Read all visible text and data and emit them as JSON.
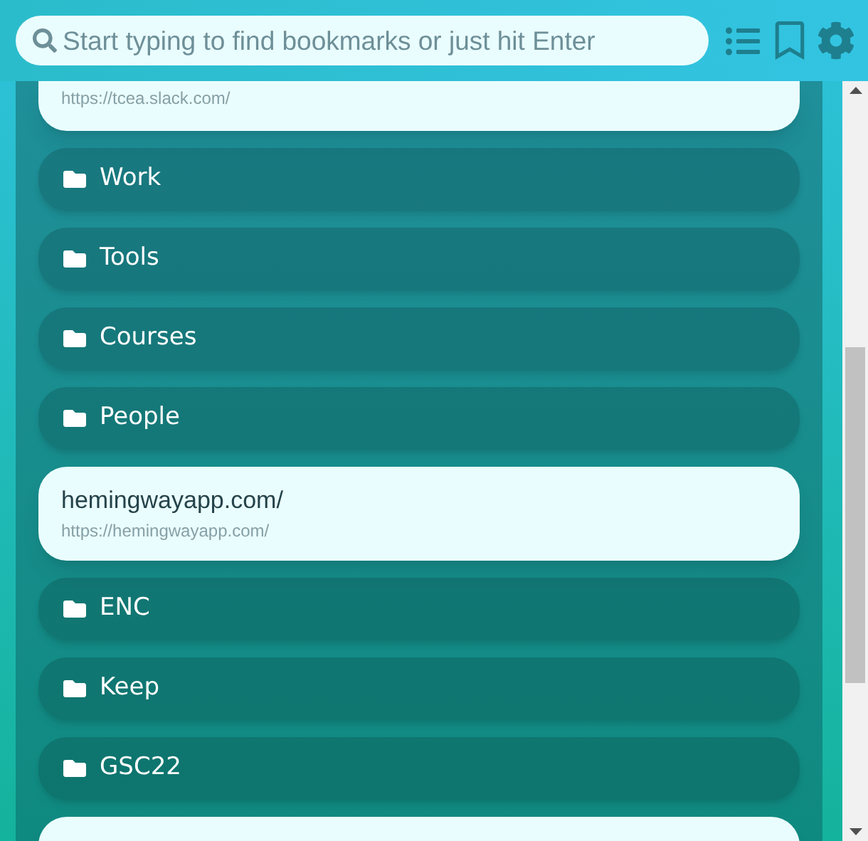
{
  "search": {
    "placeholder": "Start typing to find bookmarks or just hit Enter"
  },
  "items": [
    {
      "kind": "bookmark",
      "url": "https://tcea.slack.com/"
    },
    {
      "kind": "folder",
      "title": "Work"
    },
    {
      "kind": "folder",
      "title": "Tools"
    },
    {
      "kind": "folder",
      "title": "Courses"
    },
    {
      "kind": "folder",
      "title": "People"
    },
    {
      "kind": "bookmark",
      "title": "hemingwayapp.com/",
      "url": "https://hemingwayapp.com/"
    },
    {
      "kind": "folder",
      "title": "ENC"
    },
    {
      "kind": "folder",
      "title": "Keep"
    },
    {
      "kind": "folder",
      "title": "GSC22"
    },
    {
      "kind": "bookmark"
    }
  ]
}
